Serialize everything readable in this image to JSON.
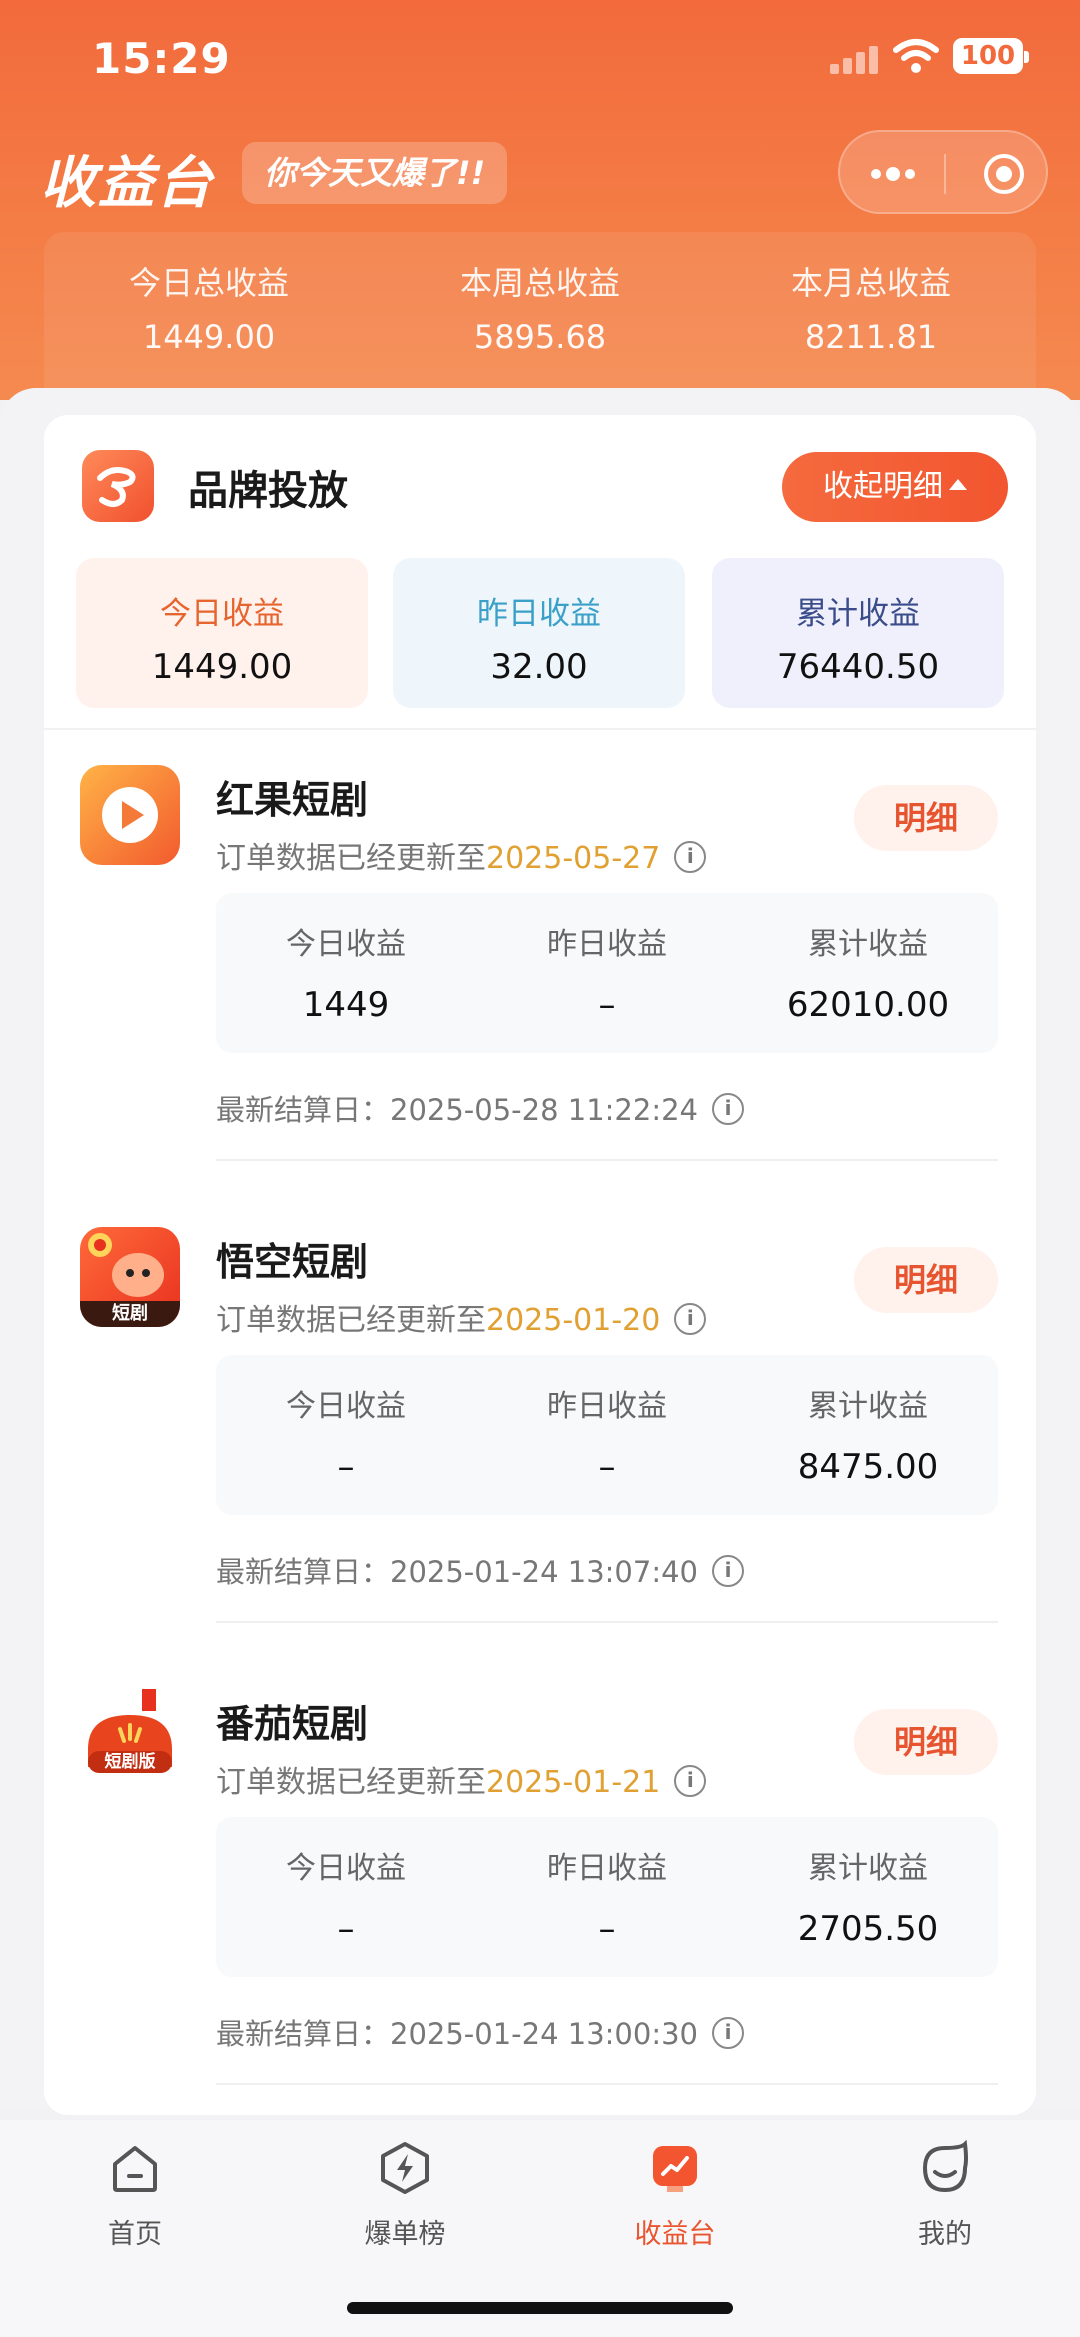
{
  "status": {
    "time": "15:29",
    "battery": "100"
  },
  "header": {
    "title": "收益台",
    "slogan": "你今天又爆了!!"
  },
  "totals": [
    {
      "label": "今日总收益",
      "value": "1449.00"
    },
    {
      "label": "本周总收益",
      "value": "5895.68"
    },
    {
      "label": "本月总收益",
      "value": "8211.81"
    }
  ],
  "brand": {
    "title": "品牌投放",
    "collapse_label": "收起明细",
    "stats": [
      {
        "label": "今日收益",
        "value": "1449.00"
      },
      {
        "label": "昨日收益",
        "value": "32.00"
      },
      {
        "label": "累计收益",
        "value": "76440.50"
      }
    ]
  },
  "dramas": [
    {
      "name": "红果短剧",
      "update_prefix": "订单数据已经更新至",
      "update_date": "2025-05-27",
      "detail_label": "明细",
      "cols": [
        {
          "label": "今日收益",
          "value": "1449"
        },
        {
          "label": "昨日收益",
          "value": "–"
        },
        {
          "label": "累计收益",
          "value": "62010.00"
        }
      ],
      "settle": "最新结算日：2025-05-28 11:22:24"
    },
    {
      "name": "悟空短剧",
      "update_prefix": "订单数据已经更新至",
      "update_date": "2025-01-20",
      "detail_label": "明细",
      "icon_text": "短剧",
      "cols": [
        {
          "label": "今日收益",
          "value": "–"
        },
        {
          "label": "昨日收益",
          "value": "–"
        },
        {
          "label": "累计收益",
          "value": "8475.00"
        }
      ],
      "settle": "最新结算日：2025-01-24 13:07:40"
    },
    {
      "name": "番茄短剧",
      "update_prefix": "订单数据已经更新至",
      "update_date": "2025-01-21",
      "detail_label": "明细",
      "icon_text": "短剧版",
      "cols": [
        {
          "label": "今日收益",
          "value": "–"
        },
        {
          "label": "昨日收益",
          "value": "–"
        },
        {
          "label": "累计收益",
          "value": "2705.50"
        }
      ],
      "settle": "最新结算日：2025-01-24 13:00:30"
    }
  ],
  "nav": [
    {
      "label": "首页",
      "icon": "home-icon"
    },
    {
      "label": "爆单榜",
      "icon": "lightning-icon"
    },
    {
      "label": "收益台",
      "icon": "chart-icon"
    },
    {
      "label": "我的",
      "icon": "face-icon"
    }
  ],
  "colors": {
    "accent": "#f2552f",
    "date": "#e0a032"
  }
}
